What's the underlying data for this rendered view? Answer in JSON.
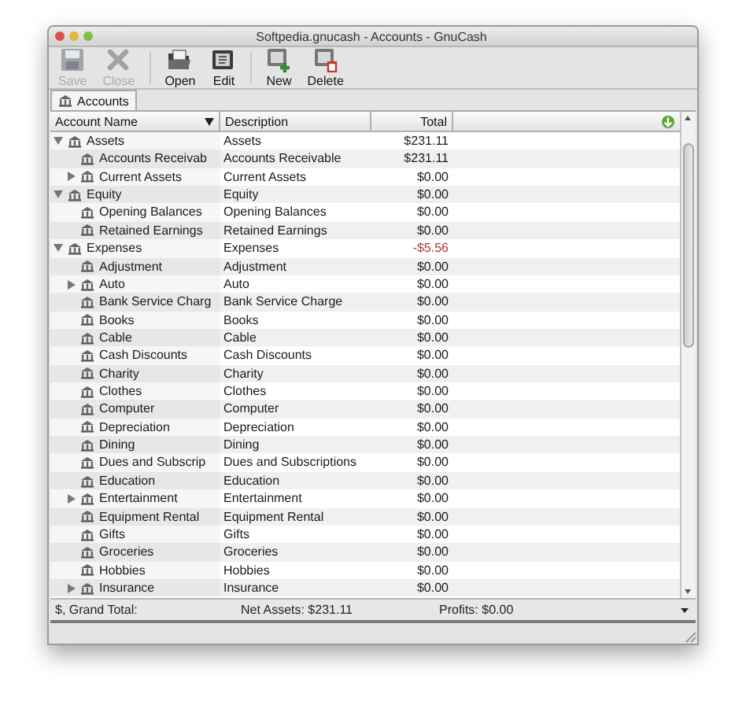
{
  "window": {
    "title": "Softpedia.gnucash - Accounts - GnuCash"
  },
  "toolbar": [
    [
      {
        "kind": "save",
        "label": "Save",
        "disabled": true
      },
      {
        "kind": "close",
        "label": "Close",
        "disabled": true
      }
    ],
    [
      {
        "kind": "open",
        "label": "Open",
        "disabled": false
      },
      {
        "kind": "edit",
        "label": "Edit",
        "disabled": false
      }
    ],
    [
      {
        "kind": "new",
        "label": "New",
        "disabled": false
      },
      {
        "kind": "delete",
        "label": "Delete",
        "disabled": false
      }
    ]
  ],
  "tabs": [
    {
      "label": "Accounts",
      "selected": true
    }
  ],
  "columns": [
    {
      "label": "Account Name",
      "sorted": true
    },
    {
      "label": "Description",
      "sorted": false
    },
    {
      "label": "Total",
      "sorted": false
    }
  ],
  "accounts": [
    {
      "name": "Assets",
      "description": "Assets",
      "total": "$231.11",
      "negative": false,
      "expanded": true,
      "children": [
        {
          "name": "Accounts Receivab",
          "description": "Accounts Receivable",
          "total": "$231.11",
          "negative": false
        },
        {
          "name": "Current Assets",
          "description": "Current Assets",
          "total": "$0.00",
          "negative": false,
          "expanded": false
        }
      ]
    },
    {
      "name": "Equity",
      "description": "Equity",
      "total": "$0.00",
      "negative": false,
      "expanded": true,
      "children": [
        {
          "name": "Opening Balances",
          "description": "Opening Balances",
          "total": "$0.00",
          "negative": false
        },
        {
          "name": "Retained Earnings",
          "description": "Retained Earnings",
          "total": "$0.00",
          "negative": false
        }
      ]
    },
    {
      "name": "Expenses",
      "description": "Expenses",
      "total": "-$5.56",
      "negative": true,
      "expanded": true,
      "children": [
        {
          "name": "Adjustment",
          "description": "Adjustment",
          "total": "$0.00",
          "negative": false
        },
        {
          "name": "Auto",
          "description": "Auto",
          "total": "$0.00",
          "negative": false,
          "expanded": false
        },
        {
          "name": "Bank Service Charg",
          "description": "Bank Service Charge",
          "total": "$0.00",
          "negative": false
        },
        {
          "name": "Books",
          "description": "Books",
          "total": "$0.00",
          "negative": false
        },
        {
          "name": "Cable",
          "description": "Cable",
          "total": "$0.00",
          "negative": false
        },
        {
          "name": "Cash Discounts",
          "description": "Cash Discounts",
          "total": "$0.00",
          "negative": false
        },
        {
          "name": "Charity",
          "description": "Charity",
          "total": "$0.00",
          "negative": false
        },
        {
          "name": "Clothes",
          "description": "Clothes",
          "total": "$0.00",
          "negative": false
        },
        {
          "name": "Computer",
          "description": "Computer",
          "total": "$0.00",
          "negative": false
        },
        {
          "name": "Depreciation",
          "description": "Depreciation",
          "total": "$0.00",
          "negative": false
        },
        {
          "name": "Dining",
          "description": "Dining",
          "total": "$0.00",
          "negative": false
        },
        {
          "name": "Dues and Subscrip",
          "description": "Dues and Subscriptions",
          "total": "$0.00",
          "negative": false
        },
        {
          "name": "Education",
          "description": "Education",
          "total": "$0.00",
          "negative": false
        },
        {
          "name": "Entertainment",
          "description": "Entertainment",
          "total": "$0.00",
          "negative": false,
          "expanded": false
        },
        {
          "name": "Equipment Rental",
          "description": "Equipment Rental",
          "total": "$0.00",
          "negative": false
        },
        {
          "name": "Gifts",
          "description": "Gifts",
          "total": "$0.00",
          "negative": false
        },
        {
          "name": "Groceries",
          "description": "Groceries",
          "total": "$0.00",
          "negative": false
        },
        {
          "name": "Hobbies",
          "description": "Hobbies",
          "total": "$0.00",
          "negative": false
        },
        {
          "name": "Insurance",
          "description": "Insurance",
          "total": "$0.00",
          "negative": false,
          "expanded": false
        }
      ]
    }
  ],
  "summary": {
    "currency": "$, Grand Total:",
    "net_assets": "Net Assets: $231.11",
    "profits": "Profits: $0.00"
  }
}
